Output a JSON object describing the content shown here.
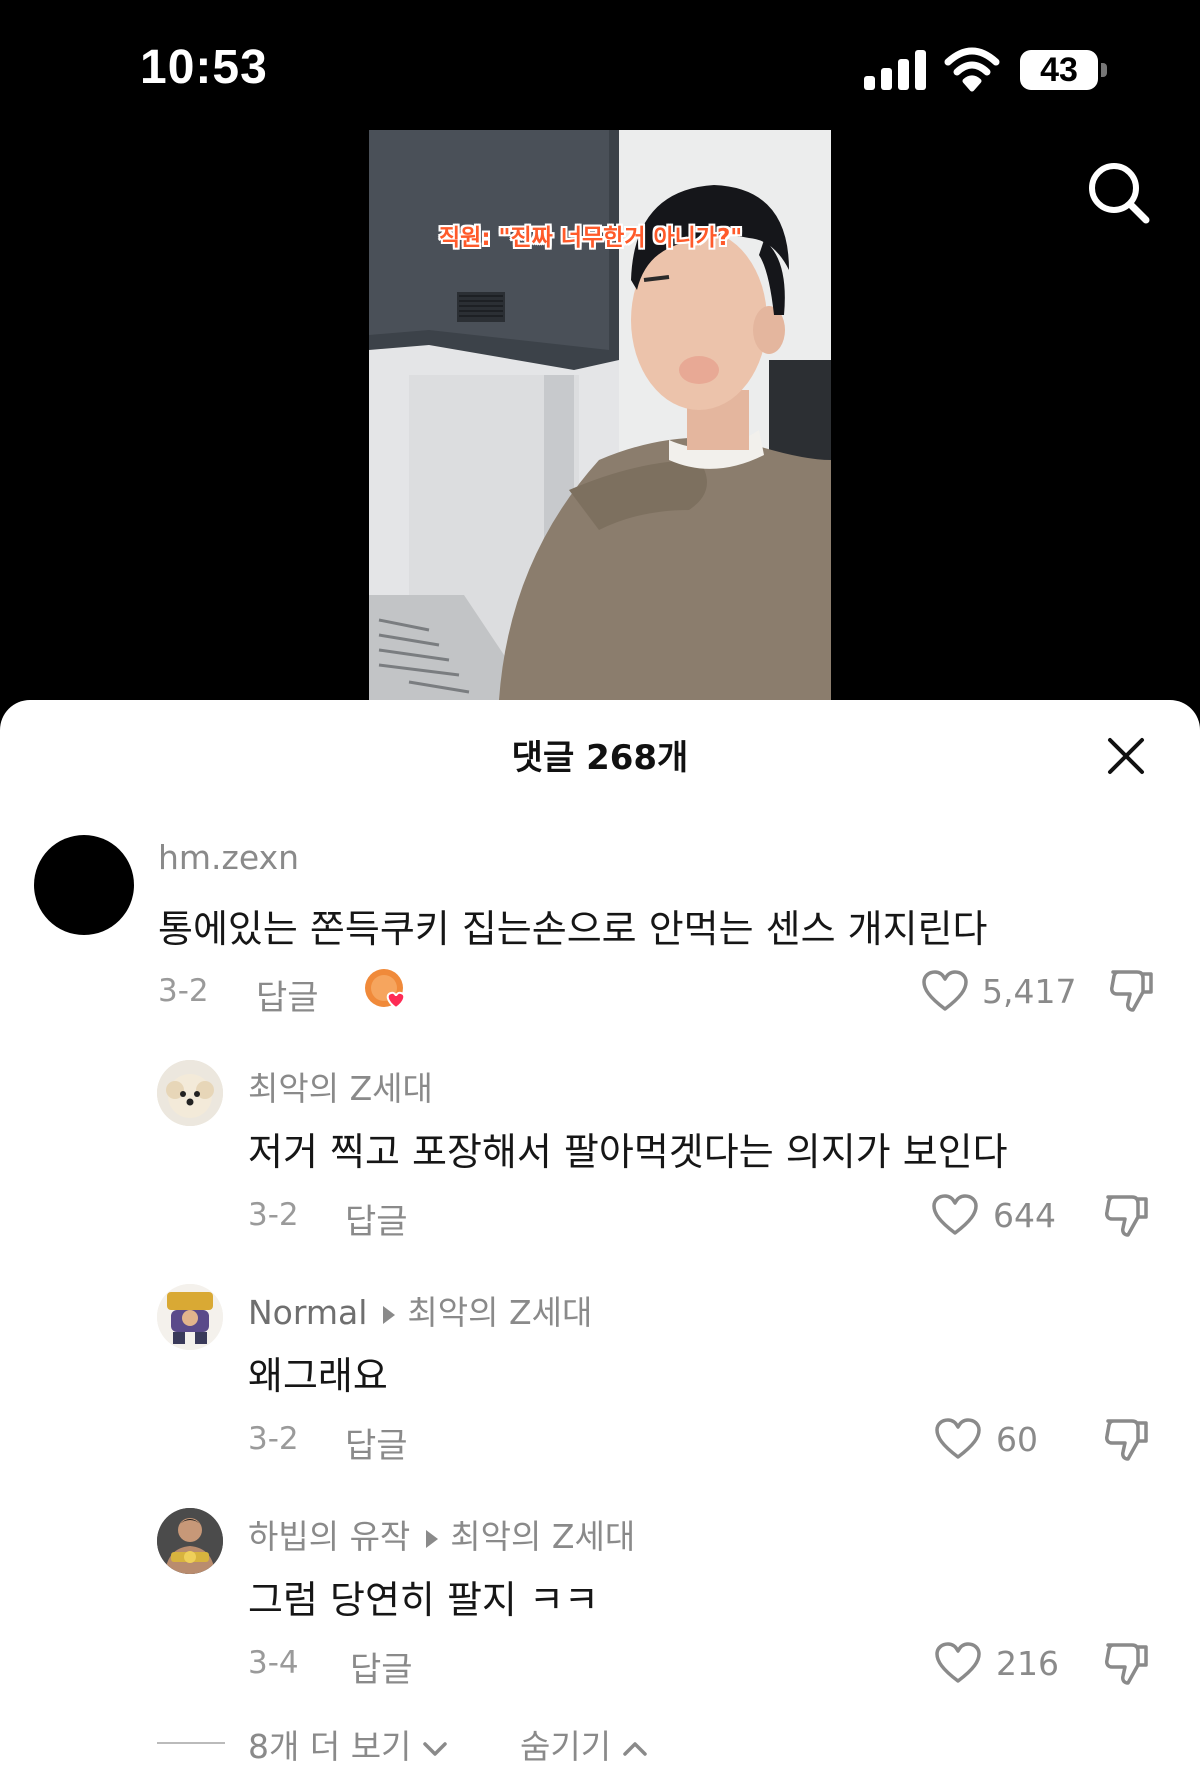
{
  "status": {
    "time": "10:53",
    "battery": "43"
  },
  "video": {
    "caption": "직원: \"진짜 너무한거 아니가?\""
  },
  "comments_sheet": {
    "title": "댓글 268개",
    "comments": [
      {
        "username": "hm.zexn",
        "text": "통에있는 쫀득쿠키 집는손으로 안먹는 센스 개지린다",
        "date": "3-2",
        "reply_label": "답글",
        "likes": "5,417"
      },
      {
        "username": "최악의 Z세대",
        "text": "저거 찍고 포장해서 팔아먹겟다는 의지가 보인다",
        "date": "3-2",
        "reply_label": "답글",
        "likes": "644"
      },
      {
        "username": "Normal",
        "reply_to": "최악의 Z세대",
        "text": "왜그래요",
        "date": "3-2",
        "reply_label": "답글",
        "likes": "60"
      },
      {
        "username": "하빕의 유작",
        "reply_to": "최악의 Z세대",
        "text": "그럼 당연히 팔지 ㅋㅋ",
        "date": "3-4",
        "reply_label": "답글",
        "likes": "216"
      }
    ],
    "view_more": "8개 더 보기",
    "hide": "숨기기"
  },
  "icons": {
    "search": "search-icon",
    "close": "close-icon",
    "like": "heart-icon",
    "dislike": "thumbs-down-icon",
    "creator_liked": "creator-liked-badge-icon",
    "chevron_down": "chevron-down-icon",
    "chevron_up": "chevron-up-icon"
  },
  "colors": {
    "background": "#000000",
    "sheet": "#ffffff",
    "caption": "#ff5a2a",
    "heart_badge": "#fe2c55"
  }
}
